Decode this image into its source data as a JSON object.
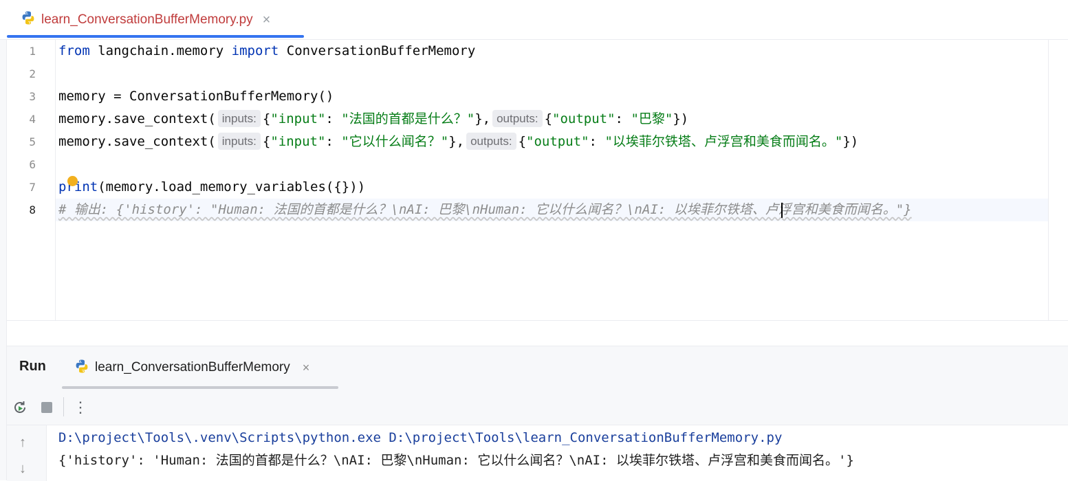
{
  "editor": {
    "tab": {
      "filename": "learn_ConversationBufferMemory.py",
      "close": "×",
      "icon": "python-icon"
    },
    "line_numbers": [
      "1",
      "2",
      "3",
      "4",
      "5",
      "6",
      "7",
      "8"
    ],
    "lines": {
      "l1": {
        "kw1": "from",
        "mod": " langchain.memory ",
        "kw2": "import",
        "cls": " ConversationBufferMemory"
      },
      "l3": {
        "text": "memory = ConversationBufferMemory()"
      },
      "l4": {
        "pre": "memory.save_context(",
        "hint1": "inputs:",
        "open1": "{",
        "k1": "\"input\"",
        "colon1": ": ",
        "v1": "\"法国的首都是什么？\"",
        "close1": "},",
        "hint2": "outputs:",
        "open2": "{",
        "k2": "\"output\"",
        "colon2": ": ",
        "v2": "\"巴黎\"",
        "close2": "})"
      },
      "l5": {
        "pre": "memory.save_context(",
        "hint1": "inputs:",
        "open1": "{",
        "k1": "\"input\"",
        "colon1": ": ",
        "v1": "\"它以什么闻名？\"",
        "close1": "},",
        "hint2": "outputs:",
        "open2": "{",
        "k2": "\"output\"",
        "colon2": ": ",
        "v2": "\"以埃菲尔铁塔、卢浮宫和美食而闻名。\"",
        "close2": "})"
      },
      "l7": {
        "kw": "print",
        "rest": "(memory.load_memory_variables({}))"
      },
      "l8": {
        "comment": "# 输出: {'history': \"Human: 法国的首都是什么？\\nAI: 巴黎\\nHuman: 它以什么闻名？\\nAI: 以埃菲尔铁塔、卢浮宫和美食而闻名。\"}"
      }
    }
  },
  "run": {
    "title": "Run",
    "tab_label": "learn_ConversationBufferMemory",
    "close": "×",
    "toolbar": {
      "rerun_icon": "rerun-icon",
      "stop_icon": "stop-icon",
      "more": "⋮"
    },
    "console": {
      "cmd": "D:\\project\\Tools\\.venv\\Scripts\\python.exe D:\\project\\Tools\\learn_ConversationBufferMemory.py",
      "output": "{'history': 'Human: 法国的首都是什么？\\nAI: 巴黎\\nHuman: 它以什么闻名？\\nAI: 以埃菲尔铁塔、卢浮宫和美食而闻名。'}"
    },
    "scroll": {
      "up": "↑",
      "down": "↓"
    }
  },
  "colors": {
    "accent": "#3574f0",
    "keyword": "#0033b3",
    "string": "#067d17",
    "comment": "#8c8c8c",
    "tab_text": "#c03c3c"
  }
}
